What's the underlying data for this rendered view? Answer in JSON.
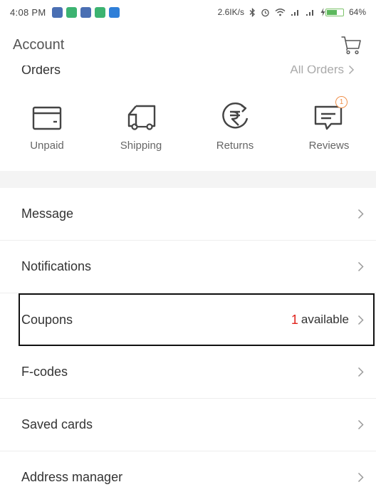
{
  "status_bar": {
    "time": "4:08 PM",
    "network_speed": "2.6IK/s",
    "battery_percent": "64%",
    "battery_level": 0.64,
    "notification_colors": [
      "#4a6fb3",
      "#3cb371",
      "#4a6fb3",
      "#3cb371",
      "#2f7fd8"
    ]
  },
  "header": {
    "title": "Account",
    "cart_icon": "cart-icon"
  },
  "orders": {
    "label": "Orders",
    "link_label": "All Orders"
  },
  "order_status": [
    {
      "label": "Unpaid",
      "icon": "wallet-icon"
    },
    {
      "label": "Shipping",
      "icon": "truck-icon"
    },
    {
      "label": "Returns",
      "icon": "rupee-return-icon"
    },
    {
      "label": "Reviews",
      "icon": "review-icon",
      "badge": "1"
    }
  ],
  "menu": {
    "message": "Message",
    "notifications": "Notifications",
    "coupons": "Coupons",
    "coupons_count": "1",
    "coupons_suffix": "available",
    "fcodes": "F-codes",
    "saved_cards": "Saved cards",
    "address_manager": "Address manager"
  },
  "colors": {
    "coupon_accent": "#e0231c",
    "badge_accent": "#f0904a",
    "highlight_border": "#111111"
  }
}
